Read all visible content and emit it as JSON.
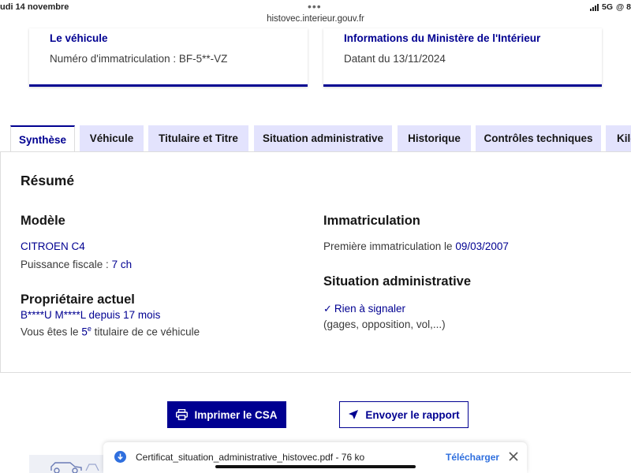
{
  "statusbar": {
    "date": "udi 14 novembre",
    "dots": "•••",
    "url": "histovec.interieur.gouv.fr",
    "network": "5G",
    "extra": "@ 8"
  },
  "cards": [
    {
      "title": "Le véhicule",
      "text": "Numéro d'immatriculation : BF-5**-VZ"
    },
    {
      "title": "Informations du Ministère de l'Intérieur",
      "text": "Datant du 13/11/2024"
    }
  ],
  "tabs": [
    {
      "label": "Synthèse",
      "active": true
    },
    {
      "label": "Véhicule"
    },
    {
      "label": "Titulaire et Titre"
    },
    {
      "label": "Situation administrative"
    },
    {
      "label": "Historique"
    },
    {
      "label": "Contrôles techniques"
    },
    {
      "label": "Kilo"
    }
  ],
  "summary": {
    "heading": "Résumé",
    "model": {
      "heading": "Modèle",
      "name": "CITROEN C4",
      "power_label": "Puissance fiscale : ",
      "power_value": "7 ch"
    },
    "owner": {
      "heading": "Propriétaire actuel",
      "name": "B****U M****L",
      "since_label": " depuis ",
      "since_value": "17 mois",
      "rank_prefix": "Vous êtes le ",
      "rank_value": "5",
      "rank_sup": "e",
      "rank_suffix": " titulaire de ce véhicule"
    },
    "registration": {
      "heading": "Immatriculation",
      "first_label": "Première immatriculation le ",
      "first_date": "09/03/2007"
    },
    "admin": {
      "heading": "Situation administrative",
      "status": "Rien à signaler",
      "detail": "(gages, opposition, vol,...)"
    }
  },
  "actions": {
    "print_label": "Imprimer le CSA",
    "send_label": "Envoyer le rapport"
  },
  "download": {
    "filename": "Certificat_situation_administrative_histovec.pdf - 76 ko",
    "action": "Télécharger"
  },
  "colors": {
    "accent": "#000091",
    "tab_bg": "#e3e3fd",
    "link_ios": "#2f6fde"
  }
}
